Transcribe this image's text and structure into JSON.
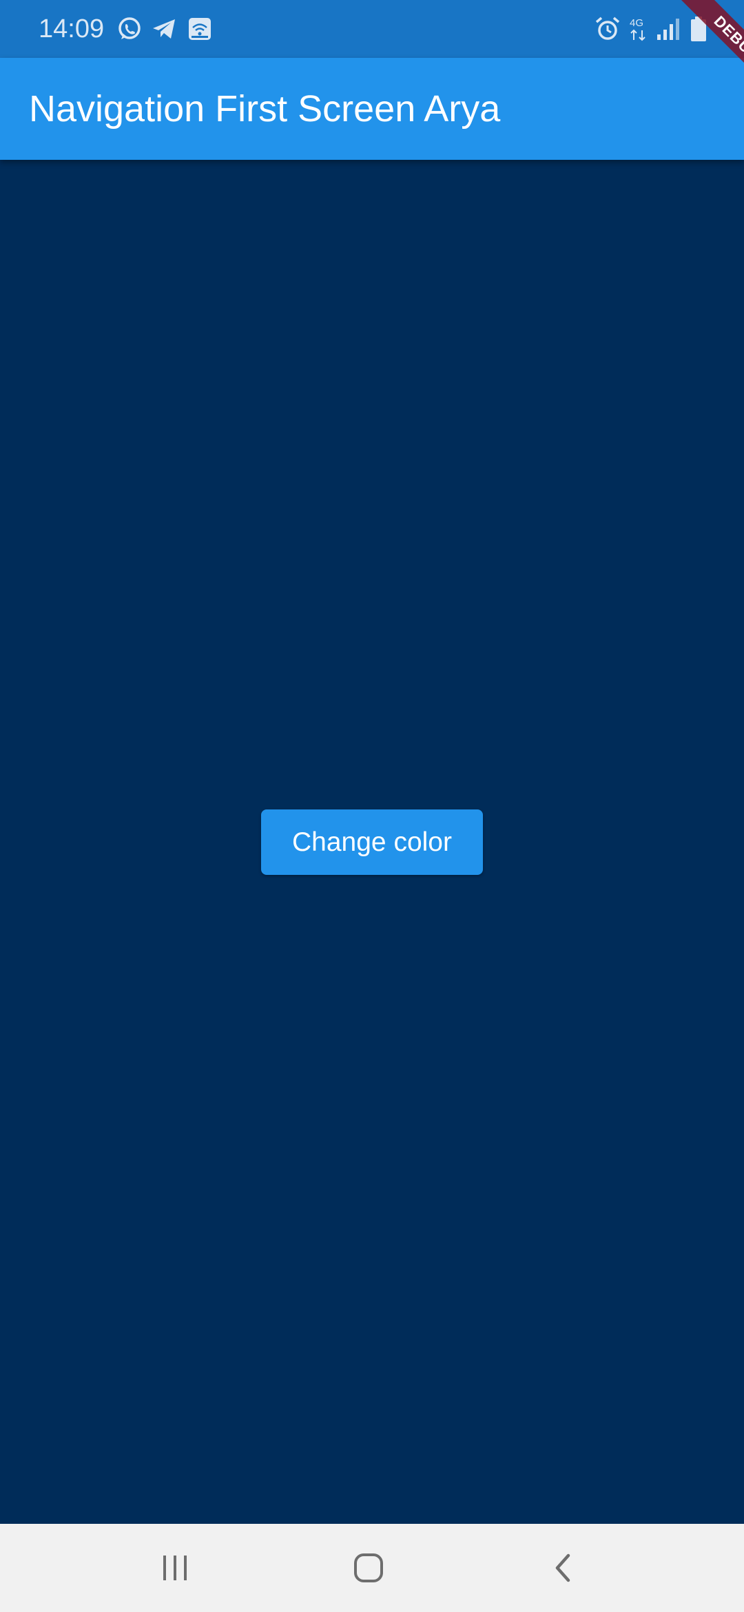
{
  "status_bar": {
    "time": "14:09",
    "network_label": "4G",
    "icons": [
      "whatsapp-icon",
      "telegram-icon",
      "wifi-calling-icon",
      "alarm-icon",
      "network-4g-icon",
      "signal-icon",
      "battery-icon"
    ]
  },
  "debug_banner": {
    "label": "DEBUG"
  },
  "app_bar": {
    "title": "Navigation First Screen Arya"
  },
  "main": {
    "button_label": "Change color"
  },
  "nav_bar": {
    "icons": [
      "recent-apps-icon",
      "home-icon",
      "back-icon"
    ]
  },
  "colors": {
    "status_bar": "#1875c5",
    "app_bar": "#2293eb",
    "background": "#002c59",
    "button": "#2293eb",
    "nav_bar": "#f1f1f1",
    "debug_ribbon": "#801428"
  }
}
